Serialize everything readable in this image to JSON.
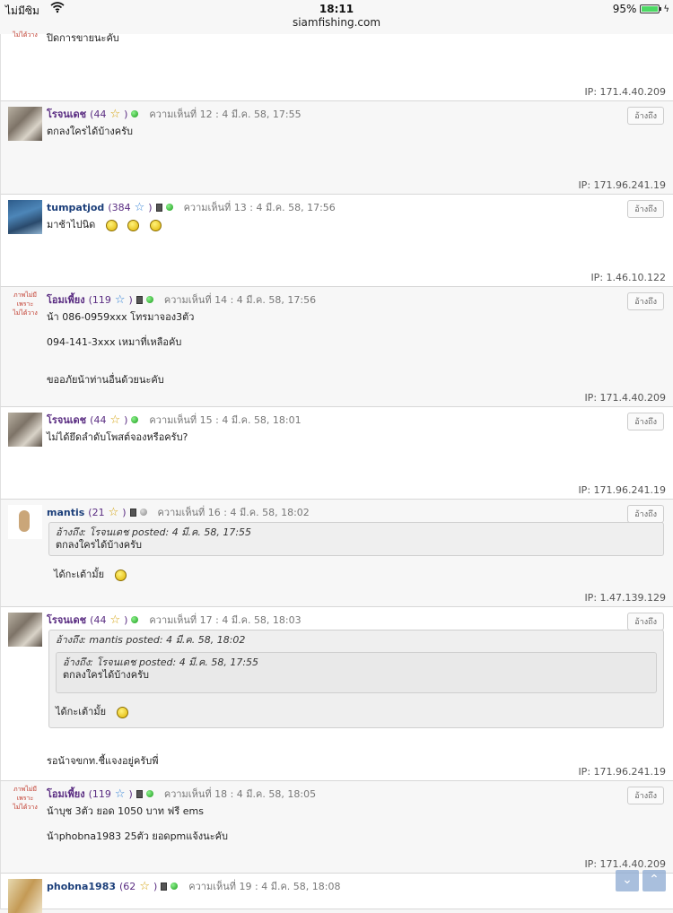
{
  "status": {
    "carrier": "ไม่มีซิม",
    "time": "18:11",
    "battery": "95%"
  },
  "url": "siamfishing.com",
  "quote_label": "อ้างถึง",
  "top_post": {
    "text": "ปิดการขายนะคับ",
    "ip": "IP: 171.4.40.209"
  },
  "posts": [
    {
      "user": "โรจนเดช",
      "count": "(44",
      "meta": "ความเห็นที่ 12 : 4 มี.ค. 58, 17:55",
      "lines": [
        "ตกลงใครได้บ้างครับ"
      ],
      "ip": "IP: 171.96.241.19"
    },
    {
      "user": "tumpatjod",
      "count": "(384",
      "meta": "ความเห็นที่ 13 : 4 มี.ค. 58, 17:56",
      "lines": [
        "มาช้าไปนิด"
      ],
      "ip": "IP: 1.46.10.122"
    },
    {
      "user": "โอมเพี้ยง",
      "count": "(119",
      "meta": "ความเห็นที่ 14 : 4 มี.ค. 58, 17:56",
      "lines": [
        "น้า 086-0959xxx โทรมาจอง3ตัว",
        "094-141-3xxx  เหมาที่เหลือคับ",
        "ขออภัยน้าท่านอื่นด้วยนะคับ"
      ],
      "ip": "IP: 171.4.40.209"
    },
    {
      "user": "โรจนเดช",
      "count": "(44",
      "meta": "ความเห็นที่ 15 : 4 มี.ค. 58, 18:01",
      "lines": [
        "ไม่ได้ยึดลำดับโพสต์จองหรือครับ?"
      ],
      "ip": "IP: 171.96.241.19"
    },
    {
      "user": "mantis",
      "count": "(21",
      "meta": "ความเห็นที่ 16 : 4 มี.ค. 58, 18:02",
      "quote_head": "อ้างถึง: โรจนเดช posted: 4 มี.ค. 58, 17:55",
      "quote_text": "ตกลงใครได้บ้างครับ",
      "lines": [
        "ได้กะเต้ามั้ย"
      ],
      "ip": "IP: 1.47.139.129"
    },
    {
      "user": "โรจนเดช",
      "count": "(44",
      "meta": "ความเห็นที่ 17 : 4 มี.ค. 58, 18:03",
      "quote_head": "อ้างถึง: mantis posted: 4 มี.ค. 58, 18:02",
      "inner_quote_head": "อ้างถึง: โรจนเดช posted: 4 มี.ค. 58, 17:55",
      "inner_quote_text": "ตกลงใครได้บ้างครับ",
      "quote_text": "ได้กะเต้ามั้ย",
      "lines": [
        "รอน้าจขกท.ชี้แจงอยู่ครับพี่"
      ],
      "ip": "IP: 171.96.241.19"
    },
    {
      "user": "โอมเพี้ยง",
      "count": "(119",
      "meta": "ความเห็นที่ 18 : 4 มี.ค. 58, 18:05",
      "lines": [
        "น้าบุช 3ตัว ยอด 1050 บาท ฟรี ems",
        "น้าphobna1983  25ตัว ยอดpmแจ้งนะคับ"
      ],
      "ip": "IP: 171.4.40.209"
    },
    {
      "user": "phobna1983",
      "count": "(62",
      "meta": "ความเห็นที่ 19 : 4 มี.ค. 58, 18:08"
    }
  ],
  "noimg_text": [
    "ภาพไม่มี",
    "เพราะ",
    "ไม่ได้วาง"
  ],
  "colors": {
    "username": "#5a2d82",
    "online": "#1a9b1a",
    "nav": "#8caad2"
  }
}
